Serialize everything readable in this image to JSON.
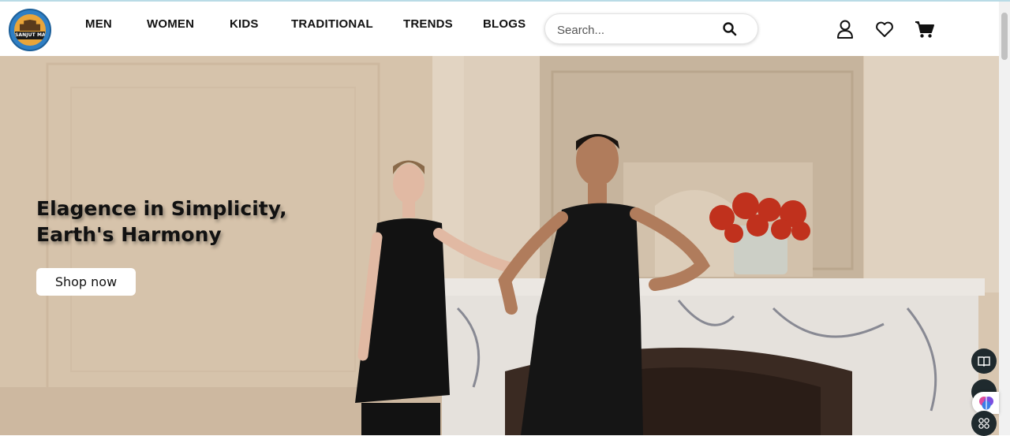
{
  "brand": {
    "logo_text": "SANJUT MART"
  },
  "nav": {
    "items": [
      {
        "label": "MEN"
      },
      {
        "label": "WOMEN"
      },
      {
        "label": "KIDS"
      },
      {
        "label": "TRADITIONAL"
      },
      {
        "label": "TRENDS"
      },
      {
        "label": "BLOGS"
      }
    ]
  },
  "search": {
    "placeholder": "Search..."
  },
  "hero": {
    "title": "Elagence in Simplicity,\nEarth's Harmony",
    "cta_label": "Shop now"
  },
  "icons": {
    "search": "search-icon",
    "account": "user-icon",
    "wishlist": "heart-icon",
    "cart": "cart-icon",
    "reader": "book-icon",
    "assistant": "brain-icon",
    "apps": "grid-icon"
  },
  "colors": {
    "header_bg": "#ffffff",
    "nav_text": "#111111",
    "hero_bg": "#d9c8b3",
    "logo_ring": "#2f7fc4",
    "logo_fill": "#e9a53a"
  }
}
